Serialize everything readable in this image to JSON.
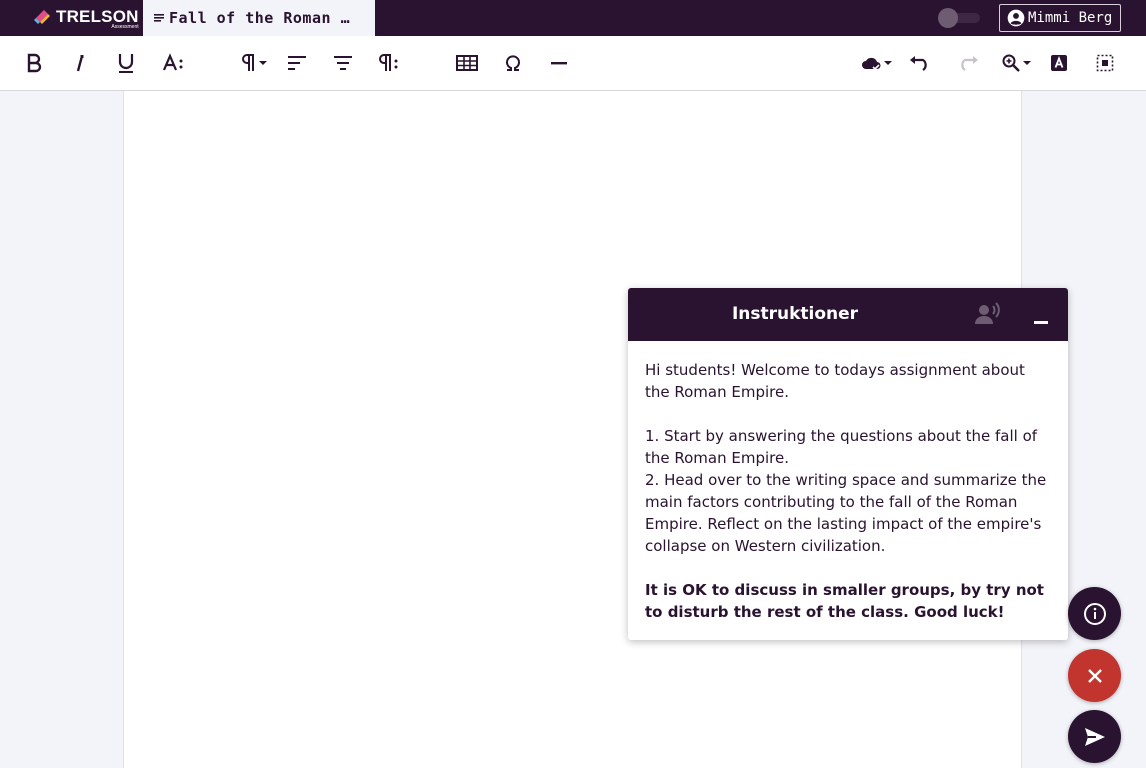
{
  "header": {
    "logo_text": "TRELSON",
    "logo_sub": "Assessment",
    "document_title": "Fall of the Roman Empire",
    "user_name": "Mimmi Berg",
    "dark_mode_toggle": "off"
  },
  "toolbar": {
    "buttons": [
      {
        "name": "bold",
        "icon": "bold-icon"
      },
      {
        "name": "italic",
        "icon": "italic-icon"
      },
      {
        "name": "underline",
        "icon": "underline-icon"
      },
      {
        "name": "text-size",
        "icon": "text-size-icon"
      },
      {
        "name": "paragraph-format",
        "icon": "paragraph-icon"
      },
      {
        "name": "align-left",
        "icon": "align-left-icon"
      },
      {
        "name": "align-center",
        "icon": "align-center-icon"
      },
      {
        "name": "paragraph-settings",
        "icon": "paragraph-settings-icon"
      },
      {
        "name": "insert-table",
        "icon": "table-icon"
      },
      {
        "name": "special-character",
        "icon": "omega-icon"
      },
      {
        "name": "horizontal-line",
        "icon": "horizontal-line-icon"
      },
      {
        "name": "spellcheck",
        "icon": "cloud-check-icon"
      },
      {
        "name": "undo",
        "icon": "undo-icon"
      },
      {
        "name": "redo",
        "icon": "redo-icon",
        "disabled": true
      },
      {
        "name": "zoom",
        "icon": "zoom-icon"
      },
      {
        "name": "highlight",
        "icon": "highlight-icon"
      },
      {
        "name": "select-all",
        "icon": "select-all-icon"
      }
    ]
  },
  "instructions": {
    "title": "Instruktioner",
    "intro": "Hi students! Welcome to todays assignment about the Roman Empire.",
    "step1": "1. Start by answering the questions about the fall of the Roman Empire.",
    "step2": "2. Head over to the writing space and summarize the main factors contributing to the fall of the Roman Empire. Reflect on the lasting impact of the empire's collapse on Western civilization.",
    "note": "It is OK to discuss in smaller groups, by try not to disturb the rest of the class. Good luck!"
  },
  "colors": {
    "brand_dark": "#2a1330",
    "close_red": "#c2352f",
    "background": "#f3f4f9"
  }
}
